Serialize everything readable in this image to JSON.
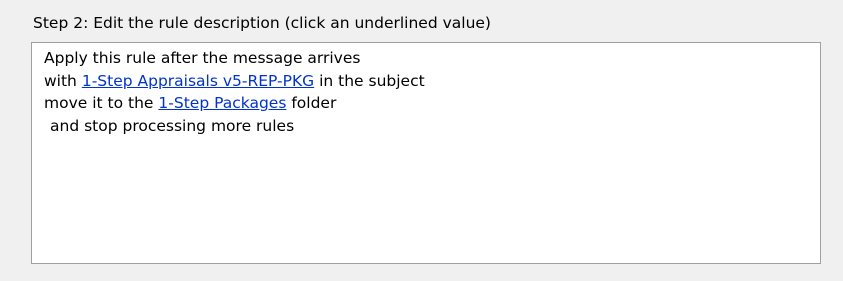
{
  "step2": {
    "title": "Step 2: Edit the rule description (click an underlined value)"
  },
  "description": {
    "line1": "Apply this rule after the message arrives",
    "line2": {
      "prefix": "with",
      "link": "1-Step Appraisals v5-REP-PKG",
      "suffix": "in the subject"
    },
    "line3": {
      "prefix": "move it to the",
      "link": "1-Step Packages",
      "suffix": "folder"
    },
    "line4": "and stop processing more rules"
  },
  "colors": {
    "background": "#f0f0f0",
    "box_background": "#ffffff",
    "box_border": "#a0a0a0",
    "link": "#0033cc",
    "text": "#000000"
  }
}
